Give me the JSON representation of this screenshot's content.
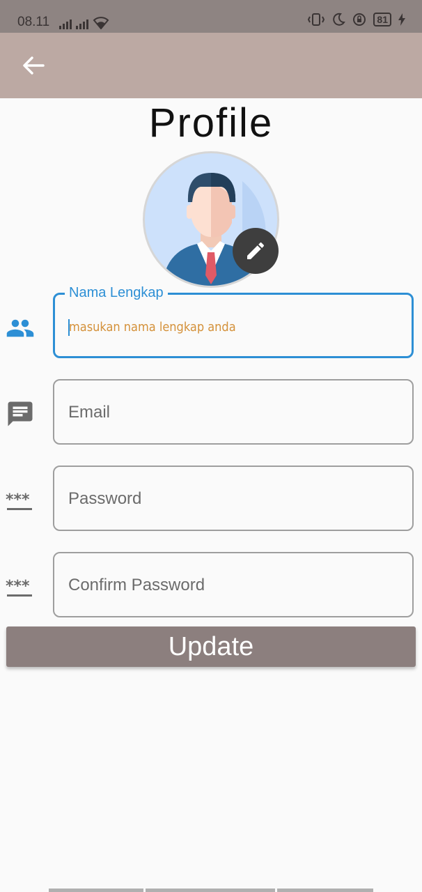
{
  "status_bar": {
    "time": "08.11",
    "battery": "81"
  },
  "page": {
    "title": "Profile"
  },
  "form": {
    "full_name": {
      "label": "Nama Lengkap",
      "placeholder": "masukan nama lengkap anda",
      "value": ""
    },
    "email": {
      "placeholder": "Email",
      "value": ""
    },
    "password": {
      "placeholder": "Password",
      "value": ""
    },
    "confirm_password": {
      "placeholder": "Confirm Password",
      "value": ""
    }
  },
  "actions": {
    "update_label": "Update"
  },
  "icons": {
    "back": "arrow-left-icon",
    "edit": "pencil-icon",
    "name": "people-icon",
    "email": "message-icon",
    "password": "password-icon",
    "confirm_password": "password-icon"
  },
  "colors": {
    "app_bar": "#bca9a3",
    "status_bar": "#8e8482",
    "accent": "#2d8fd5",
    "button": "#8c7f7e",
    "placeholder_focused": "#d4913a"
  }
}
